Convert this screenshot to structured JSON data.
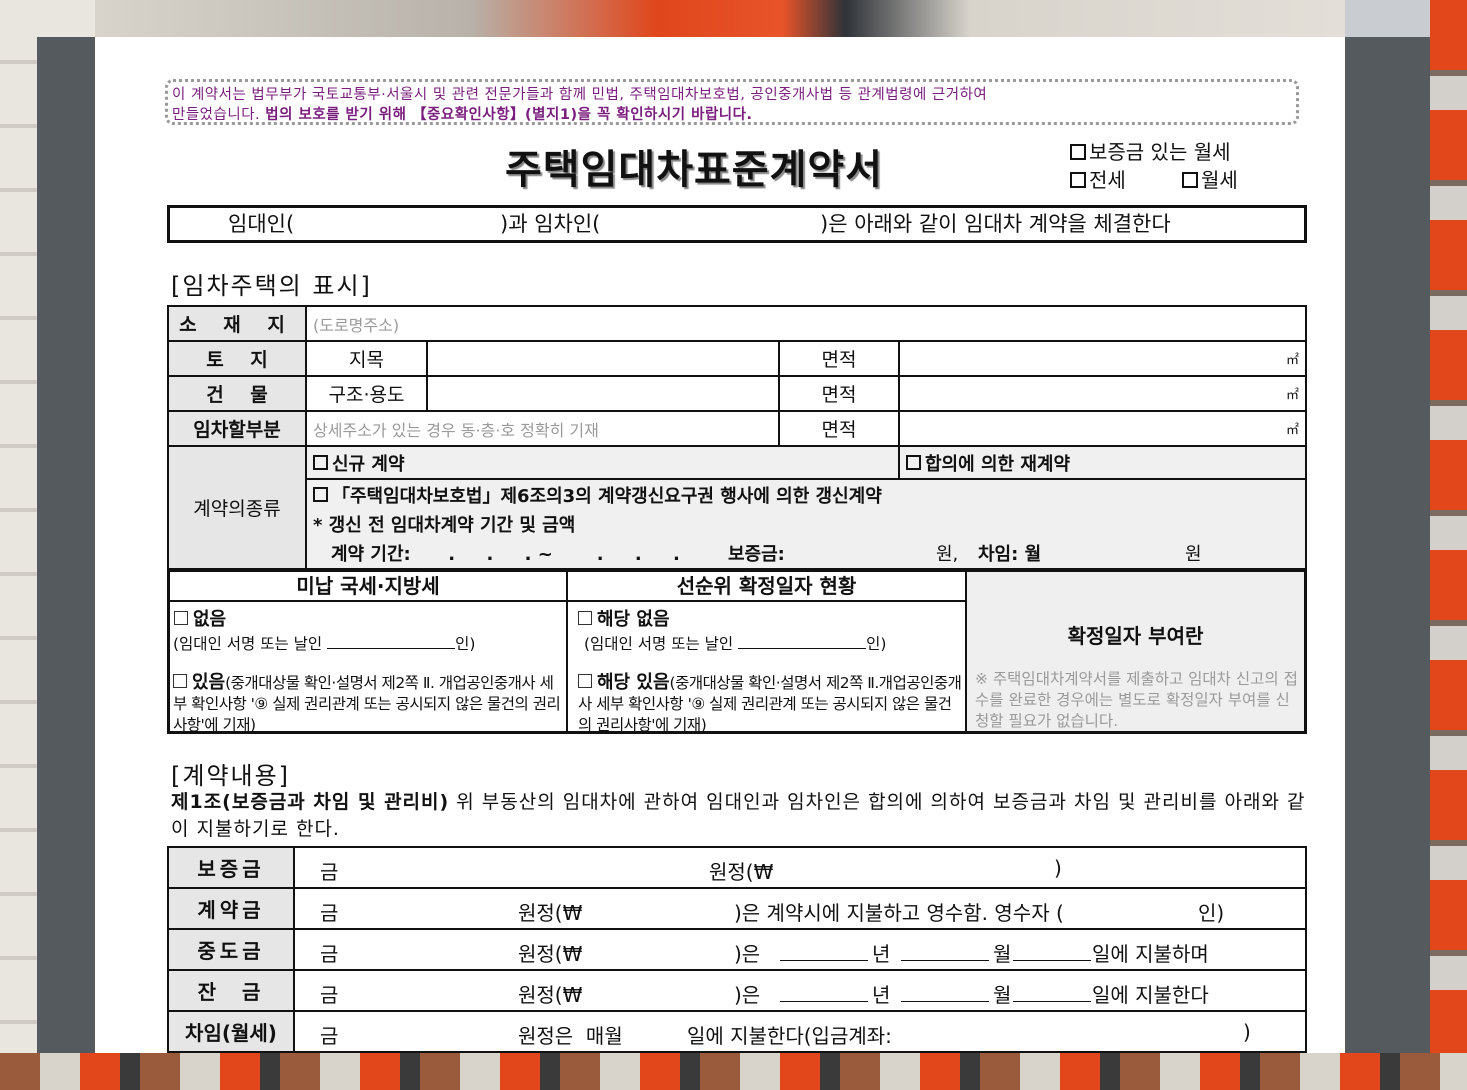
{
  "notice": {
    "line1": "이 계약서는 법무부가 국토교통부·서울시 및 관련 전문가들과 함께 민법, 주택임대차보호법, 공인중개사법 등 관계법령에 근거하여",
    "line2_plain": "만들었습니다. ",
    "line2_bold": "법의 보호를 받기 위해 【중요확인사항】(별지1)을 꼭 확인하시기 바랍니다."
  },
  "title": "주택임대차표준계약서",
  "contract_types": {
    "monthly_with_deposit": "보증금 있는 월세",
    "jeonse": "전세",
    "monthly": "월세"
  },
  "party_line": {
    "lessor": "임대인(",
    "lessee": ")과 임차인(",
    "tail": ")은 아래와 같이 임대차 계약을 체결한다"
  },
  "section1": "[임차주택의 표시]",
  "property": {
    "location_label": "소 재 지",
    "location_placeholder": "(도로명주소)",
    "land_label": "토    지",
    "land_sub": "지목",
    "building_label": "건    물",
    "building_sub": "구조·용도",
    "area_label": "면적",
    "unit": "㎡",
    "leased_part_label": "임차할부분",
    "leased_part_placeholder": "상세주소가 있는 경우 동·층·호 정확히 기재",
    "contract_kind_label": "계약의종류",
    "new_contract": "신규 계약",
    "re_contract": "합의에 의한 재계약",
    "renewal": "「주택임대차보호법」제6조의3의 계약갱신요구권 행사에 의한 갱신계약",
    "prior_note": "* 갱신 전 임대차계약 기간 및 금액",
    "prior_period": "계약 기간:      .     .     . ~       .     .     .",
    "prior_deposit": "보증금:",
    "won": "원,",
    "prior_rent": "차임: 월",
    "won2": "원"
  },
  "tax": {
    "col1_head": "미납 국세·지방세",
    "col2_head": "선순위 확정일자 현황",
    "none": "없음",
    "sign_line": "(임대인 서명 또는 날인",
    "seal": "인)",
    "exists": "있음",
    "exists_note": "(중개대상물 확인·설명서 제2쪽 Ⅱ. 개업공인중개사 세부 확인사항 '⑨ 실제 권리관계 또는 공시되지 않은 물건의 권리사항'에 기재)",
    "not_applicable": "해당 없음",
    "applicable": "해당 있음",
    "applicable_note": "(중개대상물 확인·설명서 제2쪽 Ⅱ.개업공인중개사 세부 확인사항 '⑨ 실제 권리관계 또는 공시되지 않은 물건의 권리사항'에 기재)",
    "col3_head": "확정일자 부여란",
    "col3_note": "※ 주택임대차계약서를 제출하고 임대차 신고의 접수를 완료한 경우에는 별도로 확정일자 부여를 신청할 필요가 없습니다."
  },
  "section2": "[계약내용]",
  "article1": {
    "bold": "제1조(보증금과 차임 및 관리비)",
    "text": " 위 부동산의 임대차에 관하여 임대인과 임차인은 합의에 의하여 보증금과 차임 및 관리비를 아래와 같이 지불하기로 한다."
  },
  "payments": [
    {
      "label": "보증금",
      "geum": "금",
      "a": "원정(₩",
      "b": ")",
      "c": ""
    },
    {
      "label": "계약금",
      "geum": "금",
      "a": "원정(₩",
      "b": ")은 계약시에 지불하고 영수함. 영수자 (",
      "c": "인)"
    },
    {
      "label": "중도금",
      "geum": "금",
      "a": "원정(₩",
      "b": ")은",
      "year": "년",
      "month": "월",
      "day": "일에 지불하며"
    },
    {
      "label": "잔  금",
      "geum": "금",
      "a": "원정(₩",
      "b": ")은",
      "year": "년",
      "month": "월",
      "day": "일에 지불한다"
    },
    {
      "label": "차임(월세)",
      "geum": "금",
      "a": "원정은  매월",
      "b": "일에 지불한다(입금계좌:",
      "c": ")"
    }
  ]
}
